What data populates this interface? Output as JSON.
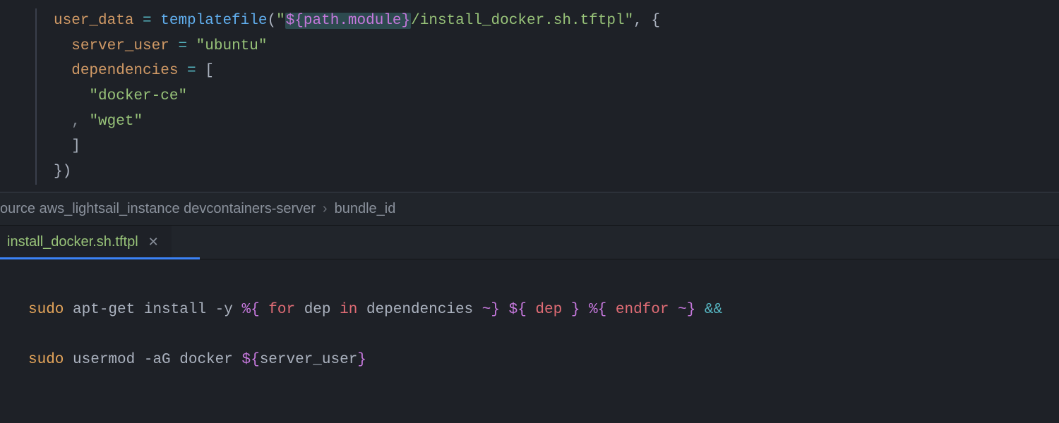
{
  "top_editor": {
    "line1": {
      "ident": "user_data",
      "eq": " = ",
      "func": "templatefile",
      "open": "(",
      "q1": "\"",
      "interp_open": "${",
      "interp_body": "path.module",
      "interp_close": "}",
      "str_tail": "/install_docker.sh.tftpl",
      "q2": "\"",
      "comma_brace": ", {"
    },
    "line2": {
      "ident": "server_user",
      "eq": " = ",
      "str": "\"ubuntu\""
    },
    "line3": {
      "ident": "dependencies",
      "eq": " = ",
      "open": "["
    },
    "line4": {
      "str": "\"docker-ce\""
    },
    "line5": {
      "comma": ", ",
      "str": "\"wget\""
    },
    "line6": {
      "close": "]"
    },
    "line7": {
      "close": "})"
    }
  },
  "breadcrumb": {
    "seg1a": "ource ",
    "seg1b": "aws_lightsail_instance",
    "seg1c": " devcontainers-server",
    "seg2": "bundle_id"
  },
  "tab": {
    "label": "install_docker.sh.tftpl"
  },
  "bottom_editor": {
    "l1": {
      "sudo": "sudo",
      "apt": " apt-get install -y ",
      "d1": "%{",
      "for": " for ",
      "dep": "dep",
      "in": " in ",
      "deps": "dependencies",
      "tilde1": " ~}",
      "sp1": " ",
      "d2": "${",
      "depvar": " dep ",
      "d2c": "}",
      "sp2": " ",
      "d3": "%{",
      "endfor": " endfor ",
      "tilde2": "~}",
      "amp": " &&"
    },
    "l2": {
      "sudo": "sudo",
      "usermod": " usermod -aG docker ",
      "d1": "${",
      "var": "server_user",
      "d1c": "}"
    }
  }
}
